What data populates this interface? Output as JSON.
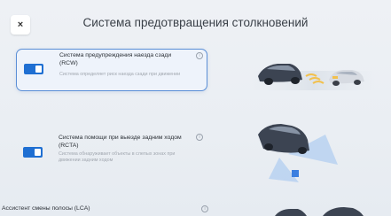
{
  "header": {
    "title": "Система предотвращения столкновений",
    "close_icon": "×"
  },
  "features": [
    {
      "title": "Система предупреждения наезда сзади (RCW)",
      "description": "Система определяет риск наезда сзади при движении",
      "enabled": true,
      "selected": true
    },
    {
      "title": "Система помощи при выезде задним ходом (RCTA)",
      "description": "Система обнаруживает объекты в слепых зонах при движении задним ходом",
      "enabled": true,
      "selected": false
    },
    {
      "title": "Ассистент смены полосы (LCA)",
      "enabled": false,
      "selected": false
    }
  ],
  "info_icon": "i",
  "colors": {
    "accent": "#1f6fd2",
    "selected_border": "#5b8fd6",
    "background": "#eaeef3"
  }
}
